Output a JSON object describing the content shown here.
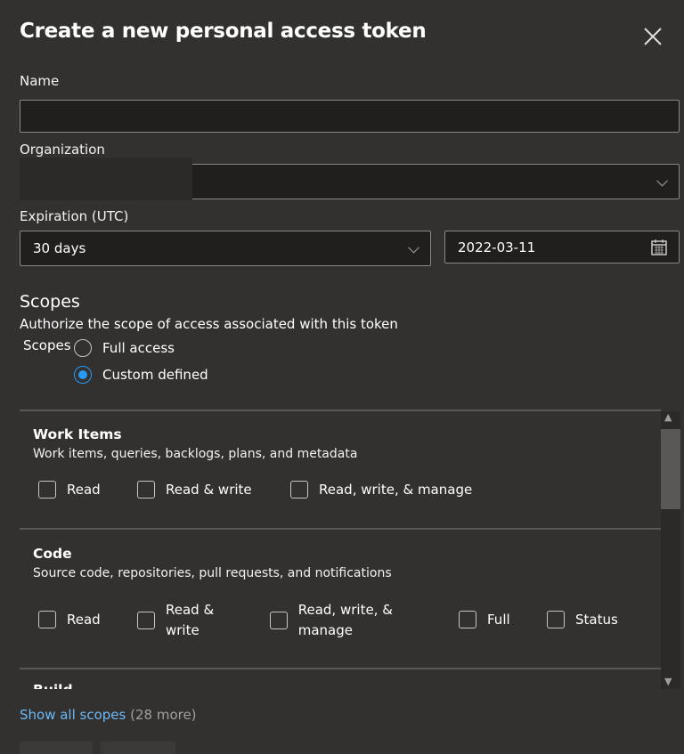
{
  "dialog": {
    "title": "Create a new personal access token"
  },
  "name": {
    "label": "Name",
    "value": ""
  },
  "organization": {
    "label": "Organization",
    "value": ""
  },
  "expiration": {
    "label": "Expiration (UTC)",
    "selected": "30 days",
    "date": "2022-03-11"
  },
  "scopes": {
    "heading": "Scopes",
    "description": "Authorize the scope of access associated with this token",
    "group_label": "Scopes",
    "options": [
      "Full access",
      "Custom defined"
    ],
    "selected": "Custom defined"
  },
  "sections": [
    {
      "title": "Work Items",
      "description": "Work items, queries, backlogs, plans, and metadata",
      "options": [
        "Read",
        "Read & write",
        "Read, write, & manage"
      ]
    },
    {
      "title": "Code",
      "description": "Source code, repositories, pull requests, and notifications",
      "options": [
        "Read",
        "Read & write",
        "Read, write, & manage",
        "Full",
        "Status"
      ]
    },
    {
      "title": "Build"
    }
  ],
  "footer": {
    "show_all": "Show all scopes",
    "more": "(28 more)"
  }
}
